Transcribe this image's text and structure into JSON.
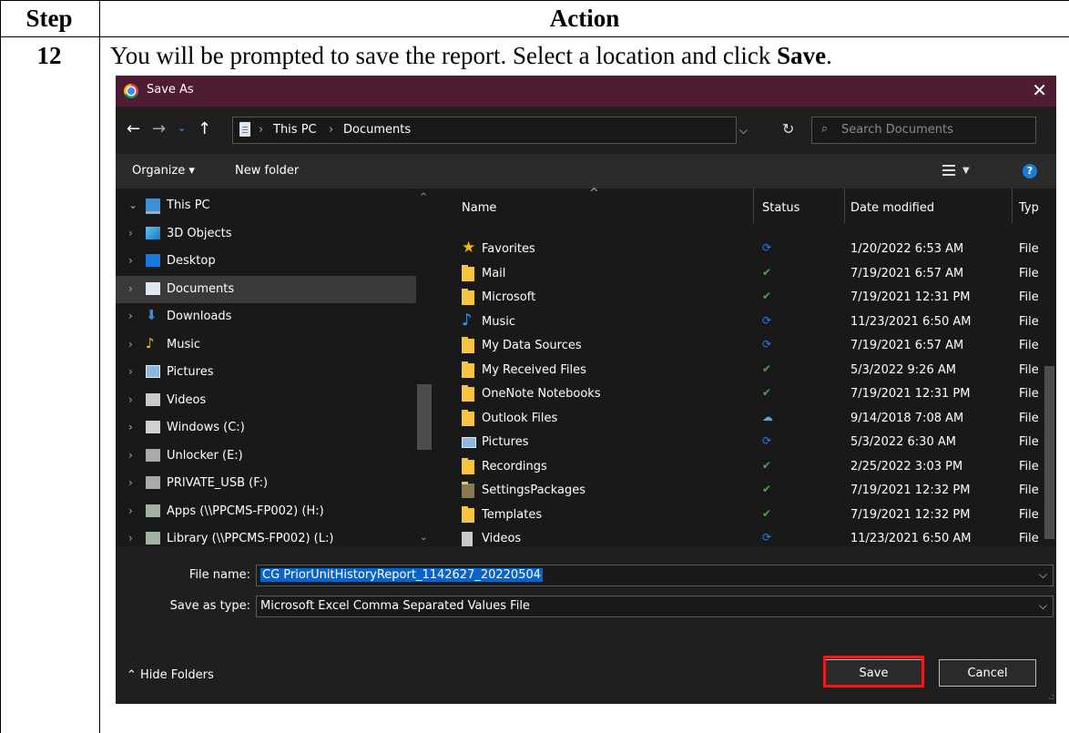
{
  "table": {
    "header_step": "Step",
    "header_action": "Action",
    "step_number": "12",
    "instruction_prefix": "You will be prompted to save the report.  Select a location and click ",
    "instruction_bold": "Save",
    "instruction_suffix": "."
  },
  "dialog": {
    "title": "Save As",
    "close_glyph": "✕",
    "address": {
      "crumbs": [
        "This PC",
        "Documents"
      ],
      "separator": "›"
    },
    "search_placeholder": "Search Documents",
    "toolbar": {
      "organize": "Organize ▾",
      "new_folder": "New folder"
    },
    "sidebar": [
      {
        "label": "This PC",
        "icon": "pc-icon",
        "expanded": true
      },
      {
        "label": "3D Objects",
        "icon": "3d-objects-icon"
      },
      {
        "label": "Desktop",
        "icon": "desktop-icon"
      },
      {
        "label": "Documents",
        "icon": "documents-icon",
        "selected": true
      },
      {
        "label": "Downloads",
        "icon": "downloads-icon"
      },
      {
        "label": "Music",
        "icon": "music-icon"
      },
      {
        "label": "Pictures",
        "icon": "pictures-icon"
      },
      {
        "label": "Videos",
        "icon": "videos-icon"
      },
      {
        "label": "Windows (C:)",
        "icon": "drive-icon"
      },
      {
        "label": "Unlocker (E:)",
        "icon": "usb-drive-icon"
      },
      {
        "label": "PRIVATE_USB (F:)",
        "icon": "usb-drive-icon"
      },
      {
        "label": "Apps (\\\\PPCMS-FP002) (H:)",
        "icon": "network-drive-icon"
      },
      {
        "label": "Library (\\\\PPCMS-FP002) (L:)",
        "icon": "network-drive-icon"
      }
    ],
    "columns": {
      "name": "Name",
      "status": "Status",
      "date": "Date modified",
      "type": "Typ"
    },
    "files": [
      {
        "name": "Favorites",
        "icon": "star-icon",
        "status": "sync",
        "date": "1/20/2022 6:53 AM",
        "type": "File"
      },
      {
        "name": "Mail",
        "icon": "folder-icon",
        "status": "ok",
        "date": "7/19/2021 6:57 AM",
        "type": "File"
      },
      {
        "name": "Microsoft",
        "icon": "folder-icon",
        "status": "ok",
        "date": "7/19/2021 12:31 PM",
        "type": "File"
      },
      {
        "name": "Music",
        "icon": "music-icon",
        "status": "sync",
        "date": "11/23/2021 6:50 AM",
        "type": "File"
      },
      {
        "name": "My Data Sources",
        "icon": "folder-icon",
        "status": "sync",
        "date": "7/19/2021 6:57 AM",
        "type": "File"
      },
      {
        "name": "My Received Files",
        "icon": "folder-icon",
        "status": "ok",
        "date": "5/3/2022 9:26 AM",
        "type": "File"
      },
      {
        "name": "OneNote Notebooks",
        "icon": "folder-icon",
        "status": "ok",
        "date": "7/19/2021 12:31 PM",
        "type": "File"
      },
      {
        "name": "Outlook Files",
        "icon": "folder-icon",
        "status": "cloud",
        "date": "9/14/2018 7:08 AM",
        "type": "File"
      },
      {
        "name": "Pictures",
        "icon": "pictures-icon",
        "status": "sync",
        "date": "5/3/2022 6:30 AM",
        "type": "File"
      },
      {
        "name": "Recordings",
        "icon": "folder-icon",
        "status": "ok",
        "date": "2/25/2022 3:03 PM",
        "type": "File"
      },
      {
        "name": "SettingsPackages",
        "icon": "folder-icon",
        "status": "ok",
        "date": "7/19/2021 12:32 PM",
        "type": "File"
      },
      {
        "name": "Templates",
        "icon": "folder-icon",
        "status": "ok",
        "date": "7/19/2021 12:32 PM",
        "type": "File"
      },
      {
        "name": "Videos",
        "icon": "videos-icon",
        "status": "sync",
        "date": "11/23/2021 6:50 AM",
        "type": "File"
      }
    ],
    "file_name_label": "File name:",
    "file_name_value": "CG PriorUnitHistoryReport_1142627_20220504",
    "save_type_label": "Save as type:",
    "save_type_value": "Microsoft Excel Comma Separated Values File",
    "hide_folders": "Hide Folders",
    "save_button": "Save",
    "cancel_button": "Cancel",
    "colors": {
      "titlebar": "#4f1d33",
      "highlight_box": "#e0201e",
      "selection": "#0a64c8"
    }
  }
}
